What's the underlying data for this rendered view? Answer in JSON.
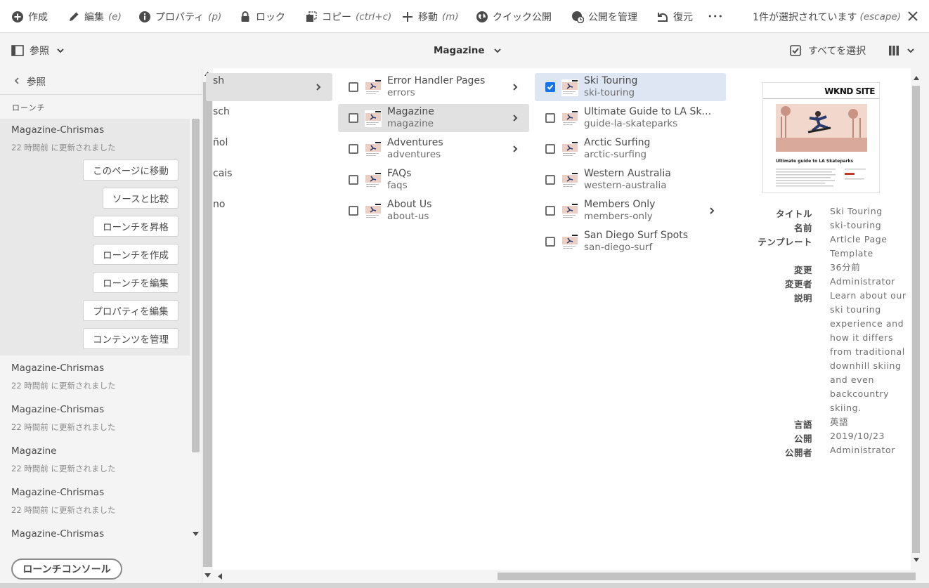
{
  "actionbar": {
    "create": "作成",
    "edit": "編集",
    "edit_shortcut": "(e)",
    "properties": "プロパティ",
    "properties_shortcut": "(p)",
    "lock": "ロック",
    "copy": "コピー",
    "copy_shortcut": "(ctrl+c)",
    "move": "移動",
    "move_shortcut": "(m)",
    "quick_publish": "クイック公開",
    "manage_publication": "公開を管理",
    "restore": "復元",
    "more": "•••",
    "selection_status": "1件が選択されています",
    "selection_shortcut": "(escape)"
  },
  "header": {
    "rail_label": "参照",
    "title": "Magazine",
    "select_all": "すべてを選択"
  },
  "rail": {
    "back_label": "参照",
    "heading": "ローンチ",
    "launches": [
      {
        "title": "Magazine-Chrismas",
        "meta": "22 時間前 に更新されました"
      },
      {
        "title": "Magazine-Chrismas",
        "meta": "22 時間前 に更新されました"
      },
      {
        "title": "Magazine-Chrismas",
        "meta": "22 時間前 に更新されました"
      },
      {
        "title": "Magazine",
        "meta": "22 時間前 に更新されました"
      },
      {
        "title": "Magazine-Chrismas",
        "meta": "22 時間前 に更新されました"
      },
      {
        "title": "Magazine-Chrismas",
        "meta": ""
      }
    ],
    "actions": [
      "このページに移動",
      "ソースと比較",
      "ローンチを昇格",
      "ローンチを作成",
      "ローンチを編集",
      "プロパティを編集",
      "コンテンツを管理"
    ],
    "console_button": "ローンチコンソール"
  },
  "columns": {
    "languages": [
      "sh",
      "sch",
      "ñol",
      "cais",
      "no"
    ],
    "site_pages": [
      {
        "title": "Error Handler Pages",
        "name": "errors",
        "has_children": true
      },
      {
        "title": "Magazine",
        "name": "magazine",
        "has_children": true,
        "active": true
      },
      {
        "title": "Adventures",
        "name": "adventures",
        "has_children": true
      },
      {
        "title": "FAQs",
        "name": "faqs",
        "has_children": false
      },
      {
        "title": "About Us",
        "name": "about-us",
        "has_children": false
      }
    ],
    "magazine_pages": [
      {
        "title": "Ski Touring",
        "name": "ski-touring",
        "selected": true,
        "has_children": false
      },
      {
        "title": "Ultimate Guide to LA Skateparks",
        "name": "guide-la-skateparks",
        "has_children": false
      },
      {
        "title": "Arctic Surfing",
        "name": "arctic-surfing",
        "has_children": false
      },
      {
        "title": "Western Australia",
        "name": "western-australia",
        "has_children": false
      },
      {
        "title": "Members Only",
        "name": "members-only",
        "has_children": true
      },
      {
        "title": "San Diego Surf Spots",
        "name": "san-diego-surf",
        "has_children": false
      }
    ]
  },
  "preview": {
    "thumbnail": {
      "logo": "WKND SITE",
      "headline": "Ultimate guide to LA Skateparks"
    },
    "labels": {
      "title": "タイトル",
      "name": "名前",
      "template": "テンプレート",
      "modified": "変更",
      "modified_by": "変更者",
      "description": "説明",
      "language": "言語",
      "published": "公開",
      "published_by": "公開者"
    },
    "values": {
      "title": "Ski Touring",
      "name": "ski-touring",
      "template": "Article Page Template",
      "modified": "36分前",
      "modified_by": "Administrator",
      "description": "Learn about our ski touring experience and how it differs from traditional downhill skiing and even backcountry skiing.",
      "language": "英語",
      "published": "2019/10/23",
      "published_by": "Administrator"
    }
  },
  "colors": {
    "accent_blue": "#1473e6",
    "selected_row": "#dde6f2",
    "active_row": "#e1e1e1",
    "panel_bg": "#f4f4f4"
  }
}
